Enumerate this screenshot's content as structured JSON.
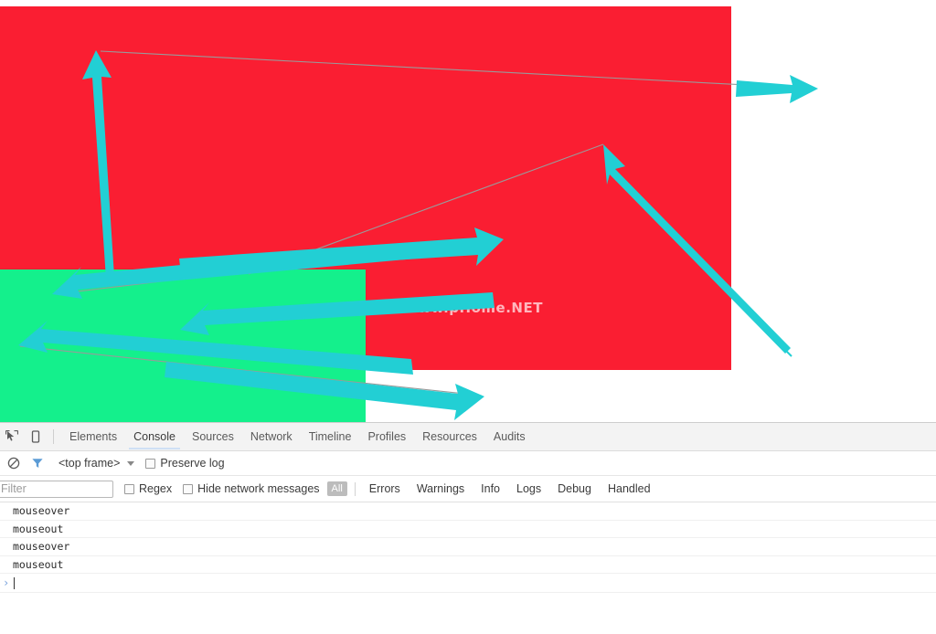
{
  "page": {
    "red_block": {
      "color": "#FA1E32",
      "name": "red-box"
    },
    "green_block": {
      "color": "#14F08C",
      "name": "green-box"
    },
    "watermark": "www.pHome.NET",
    "watermark_color": "#ffb6bd",
    "annotation_color": "#22CFD4",
    "annotation_line_color": "#9a9a9a"
  },
  "devtools": {
    "tabs": [
      {
        "label": "Elements",
        "active": false
      },
      {
        "label": "Console",
        "active": true
      },
      {
        "label": "Sources",
        "active": false
      },
      {
        "label": "Network",
        "active": false
      },
      {
        "label": "Timeline",
        "active": false
      },
      {
        "label": "Profiles",
        "active": false
      },
      {
        "label": "Resources",
        "active": false
      },
      {
        "label": "Audits",
        "active": false
      }
    ],
    "icons": {
      "inspect": "inspect-element-icon",
      "device": "device-toolbar-icon",
      "clear": "clear-console-icon",
      "filter": "filter-icon"
    },
    "framebar": {
      "frame_label": "<top frame>",
      "preserve_log_label": "Preserve log",
      "preserve_log_checked": false
    },
    "filterbar": {
      "filter_placeholder": "Filter",
      "filter_value": "",
      "regex_label": "Regex",
      "regex_checked": false,
      "hide_network_label": "Hide network messages",
      "hide_network_checked": false,
      "levels": [
        {
          "label": "All",
          "selected": true
        },
        {
          "label": "Errors",
          "selected": false
        },
        {
          "label": "Warnings",
          "selected": false
        },
        {
          "label": "Info",
          "selected": false
        },
        {
          "label": "Logs",
          "selected": false
        },
        {
          "label": "Debug",
          "selected": false
        },
        {
          "label": "Handled",
          "selected": false
        }
      ]
    },
    "console_messages": [
      "mouseover",
      "mouseout",
      "mouseover",
      "mouseout"
    ],
    "prompt": {
      "arrow": "›",
      "value": ""
    }
  }
}
